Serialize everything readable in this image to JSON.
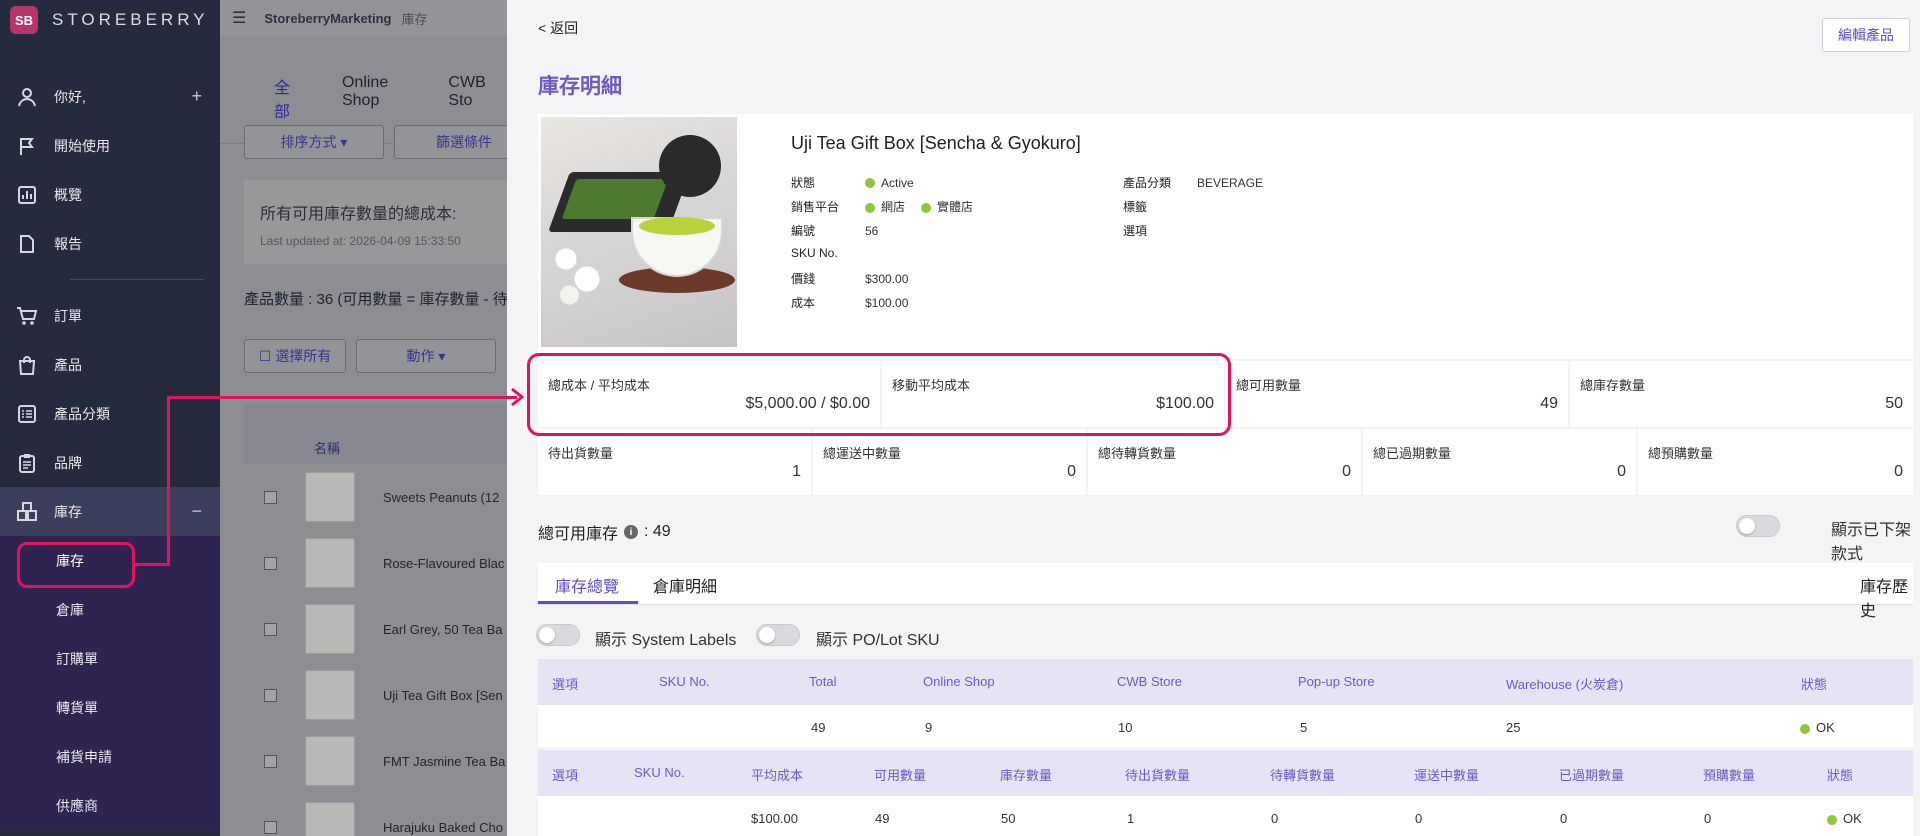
{
  "brand": {
    "logo_text": "STOREBERRY",
    "logo_mark": "SB"
  },
  "sidebar": {
    "items": [
      {
        "label": "你好,",
        "icon": "user-icon",
        "trail": "+"
      },
      {
        "label": "開始使用",
        "icon": "flag-icon"
      },
      {
        "label": "概覽",
        "icon": "chart-icon"
      },
      {
        "label": "報告",
        "icon": "document-icon"
      },
      {
        "label": "訂單",
        "icon": "cart-icon"
      },
      {
        "label": "產品",
        "icon": "bag-icon"
      },
      {
        "label": "產品分類",
        "icon": "list-icon"
      },
      {
        "label": "品牌",
        "icon": "clipboard-icon"
      },
      {
        "label": "庫存",
        "icon": "box-icon",
        "trail": "−"
      }
    ],
    "sub_items": [
      "庫存",
      "倉庫",
      "訂購單",
      "轉貨單",
      "補貨申請",
      "供應商"
    ]
  },
  "list_view": {
    "topbar_store": "StoreberryMarketing",
    "topbar_crumb": "庫存",
    "tabs": [
      "全部",
      "Online Shop",
      "CWB Sto"
    ],
    "sort_button": "排序方式 ▾",
    "filter_button": "篩選條件",
    "summary_title": "所有可用庫存數量的總成本:",
    "summary_updated": "Last updated at: 2026-04-09 15:33:50",
    "product_count": "產品數量 : 36 (可用數量 = 庫存數量 - 待出",
    "select_all": "☐ 選擇所有",
    "action_button": "動作 ▾",
    "col_name": "名稱",
    "rows": [
      "Sweets Peanuts (12",
      "Rose-Flavoured Blac",
      "Earl Grey, 50 Tea Ba",
      "Uji Tea Gift Box [Sen",
      "FMT Jasmine Tea Ba",
      "Harajuku Baked Cho"
    ]
  },
  "panel": {
    "back": "< 返回",
    "edit_button": "編輯產品",
    "title": "庫存明細",
    "product": {
      "name": "Uji Tea Gift Box [Sencha & Gyokuro]",
      "status_label": "狀態",
      "status_value": "Active",
      "channel_label": "銷售平台",
      "channel_1": "網店",
      "channel_2": "實體店",
      "id_label": "編號",
      "id_value": "56",
      "sku_label": "SKU No.",
      "price_label": "價錢",
      "price_value": "$300.00",
      "cost_label": "成本",
      "cost_value": "$100.00",
      "category_label": "產品分類",
      "category_value": "BEVERAGE",
      "tag_label": "標籤",
      "option_label": "選項"
    },
    "stats_row1": [
      {
        "label": "總成本 / 平均成本",
        "value": "$5,000.00 / $0.00"
      },
      {
        "label": "移動平均成本",
        "value": "$100.00"
      },
      {
        "label": "總可用數量",
        "value": "49"
      },
      {
        "label": "總庫存數量",
        "value": "50"
      }
    ],
    "stats_row2": [
      {
        "label": "待出貨數量",
        "value": "1"
      },
      {
        "label": "總運送中數量",
        "value": "0"
      },
      {
        "label": "總待轉貨數量",
        "value": "0"
      },
      {
        "label": "總已過期數量",
        "value": "0"
      },
      {
        "label": "總預購數量",
        "value": "0"
      }
    ],
    "available_label": "總可用庫存",
    "available_value": ": 49",
    "show_delisted": "顯示已下架款式",
    "tabs": [
      "庫存總覽",
      "倉庫明細"
    ],
    "history": "庫存歷史",
    "toggle_system_labels": "顯示 System Labels",
    "toggle_po_lot": "顯示 PO/Lot SKU",
    "table1": {
      "headers": [
        "選項",
        "SKU No.",
        "Total",
        "Online Shop",
        "CWB Store",
        "Pop-up Store",
        "Warehouse (火炭倉)",
        "狀態"
      ],
      "row": [
        "",
        "",
        "49",
        "9",
        "10",
        "5",
        "25",
        "OK"
      ]
    },
    "table2": {
      "headers": [
        "選項",
        "SKU No.",
        "平均成本",
        "可用數量",
        "庫存數量",
        "待出貨數量",
        "待轉貨數量",
        "運送中數量",
        "已過期數量",
        "預購數量",
        "狀態"
      ],
      "row": [
        "",
        "",
        "$100.00",
        "49",
        "50",
        "1",
        "0",
        "0",
        "0",
        "0",
        "OK"
      ]
    }
  },
  "colors": {
    "accent": "#5b4fc4",
    "highlight": "#e0135f",
    "sidebar": "#262a3e",
    "ok": "#7fbf2f"
  }
}
